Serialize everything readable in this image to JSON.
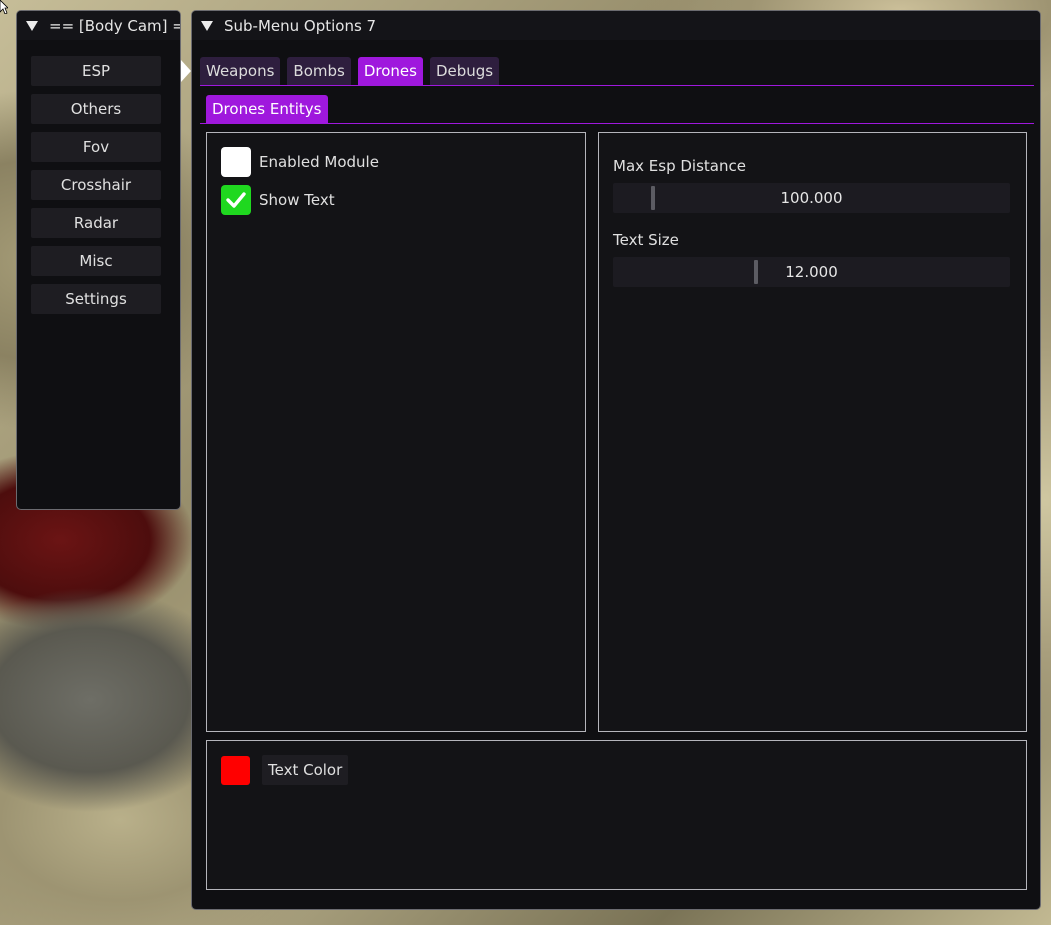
{
  "sidebar": {
    "title": "== [Body Cam] ==",
    "items": [
      {
        "label": "ESP"
      },
      {
        "label": "Others"
      },
      {
        "label": "Fov"
      },
      {
        "label": "Crosshair"
      },
      {
        "label": "Radar"
      },
      {
        "label": "Misc"
      },
      {
        "label": "Settings"
      }
    ]
  },
  "main": {
    "title": "Sub-Menu Options 7",
    "tabs": [
      {
        "label": "Weapons",
        "active": false
      },
      {
        "label": "Bombs",
        "active": false
      },
      {
        "label": "Drones",
        "active": true
      },
      {
        "label": "Debugs",
        "active": false
      }
    ],
    "subtab": {
      "label": "Drones Entitys",
      "active": true
    },
    "left_panel": {
      "checkboxes": [
        {
          "label": "Enabled Module",
          "checked": false
        },
        {
          "label": "Show Text",
          "checked": true
        }
      ]
    },
    "right_panel": {
      "sliders": [
        {
          "label": "Max Esp Distance",
          "value": "100.000",
          "position_fraction": 0.095
        },
        {
          "label": "Text Size",
          "value": "12.000",
          "position_fraction": 0.355
        }
      ]
    },
    "bottom_panel": {
      "color_label": "Text Color",
      "color": "#ff0000"
    }
  },
  "colors": {
    "accent": "#9f18dd",
    "tab_inactive": "#2e1e3e",
    "checkbox_on": "#1fd81f",
    "window_bg": "#0f0f12"
  }
}
